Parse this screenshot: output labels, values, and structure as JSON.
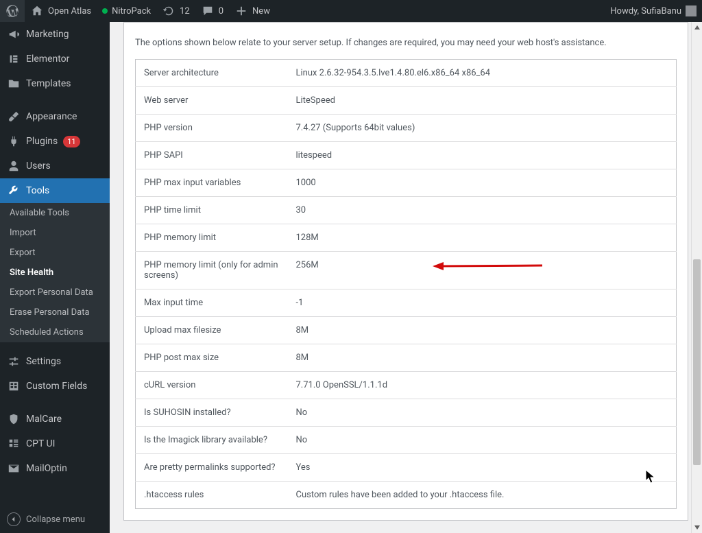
{
  "adminbar": {
    "site_name": "Open Atlas",
    "nitropack": "NitroPack",
    "updates": "12",
    "comments": "0",
    "new": "New",
    "howdy": "Howdy, SufiaBanu"
  },
  "sidebar": {
    "items": [
      {
        "key": "marketing",
        "label": "Marketing",
        "icon": "megaphone"
      },
      {
        "key": "elementor",
        "label": "Elementor",
        "icon": "elementor"
      },
      {
        "key": "templates",
        "label": "Templates",
        "icon": "folder"
      },
      {
        "key": "appearance",
        "label": "Appearance",
        "icon": "brush"
      },
      {
        "key": "plugins",
        "label": "Plugins",
        "icon": "plug",
        "badge": "11"
      },
      {
        "key": "users",
        "label": "Users",
        "icon": "person"
      },
      {
        "key": "tools",
        "label": "Tools",
        "icon": "wrench",
        "active": true
      },
      {
        "key": "settings",
        "label": "Settings",
        "icon": "sliders"
      },
      {
        "key": "custom-fields",
        "label": "Custom Fields",
        "icon": "tablecells"
      },
      {
        "key": "malcare",
        "label": "MalCare",
        "icon": "shield"
      },
      {
        "key": "cptui",
        "label": "CPT UI",
        "icon": "grid"
      },
      {
        "key": "mailoptin",
        "label": "MailOptin",
        "icon": "mail"
      }
    ],
    "tools_submenu": [
      {
        "key": "available-tools",
        "label": "Available Tools"
      },
      {
        "key": "import",
        "label": "Import"
      },
      {
        "key": "export",
        "label": "Export"
      },
      {
        "key": "site-health",
        "label": "Site Health",
        "current": true
      },
      {
        "key": "export-personal",
        "label": "Export Personal Data"
      },
      {
        "key": "erase-personal",
        "label": "Erase Personal Data"
      },
      {
        "key": "scheduled-actions",
        "label": "Scheduled Actions"
      }
    ],
    "collapse": "Collapse menu"
  },
  "panel": {
    "desc": "The options shown below relate to your server setup. If changes are required, you may need your web host's assistance.",
    "rows": [
      {
        "k": "Server architecture",
        "v": "Linux 2.6.32-954.3.5.lve1.4.80.el6.x86_64 x86_64"
      },
      {
        "k": "Web server",
        "v": "LiteSpeed"
      },
      {
        "k": "PHP version",
        "v": "7.4.27 (Supports 64bit values)"
      },
      {
        "k": "PHP SAPI",
        "v": "litespeed"
      },
      {
        "k": "PHP max input variables",
        "v": "1000"
      },
      {
        "k": "PHP time limit",
        "v": "30"
      },
      {
        "k": "PHP memory limit",
        "v": "128M"
      },
      {
        "k": "PHP memory limit (only for admin screens)",
        "v": "256M"
      },
      {
        "k": "Max input time",
        "v": "-1"
      },
      {
        "k": "Upload max filesize",
        "v": "8M"
      },
      {
        "k": "PHP post max size",
        "v": "8M"
      },
      {
        "k": "cURL version",
        "v": "7.71.0 OpenSSL/1.1.1d"
      },
      {
        "k": "Is SUHOSIN installed?",
        "v": "No"
      },
      {
        "k": "Is the Imagick library available?",
        "v": "No"
      },
      {
        "k": "Are pretty permalinks supported?",
        "v": "Yes"
      },
      {
        "k": ".htaccess rules",
        "v": "Custom rules have been added to your .htaccess file."
      }
    ]
  }
}
